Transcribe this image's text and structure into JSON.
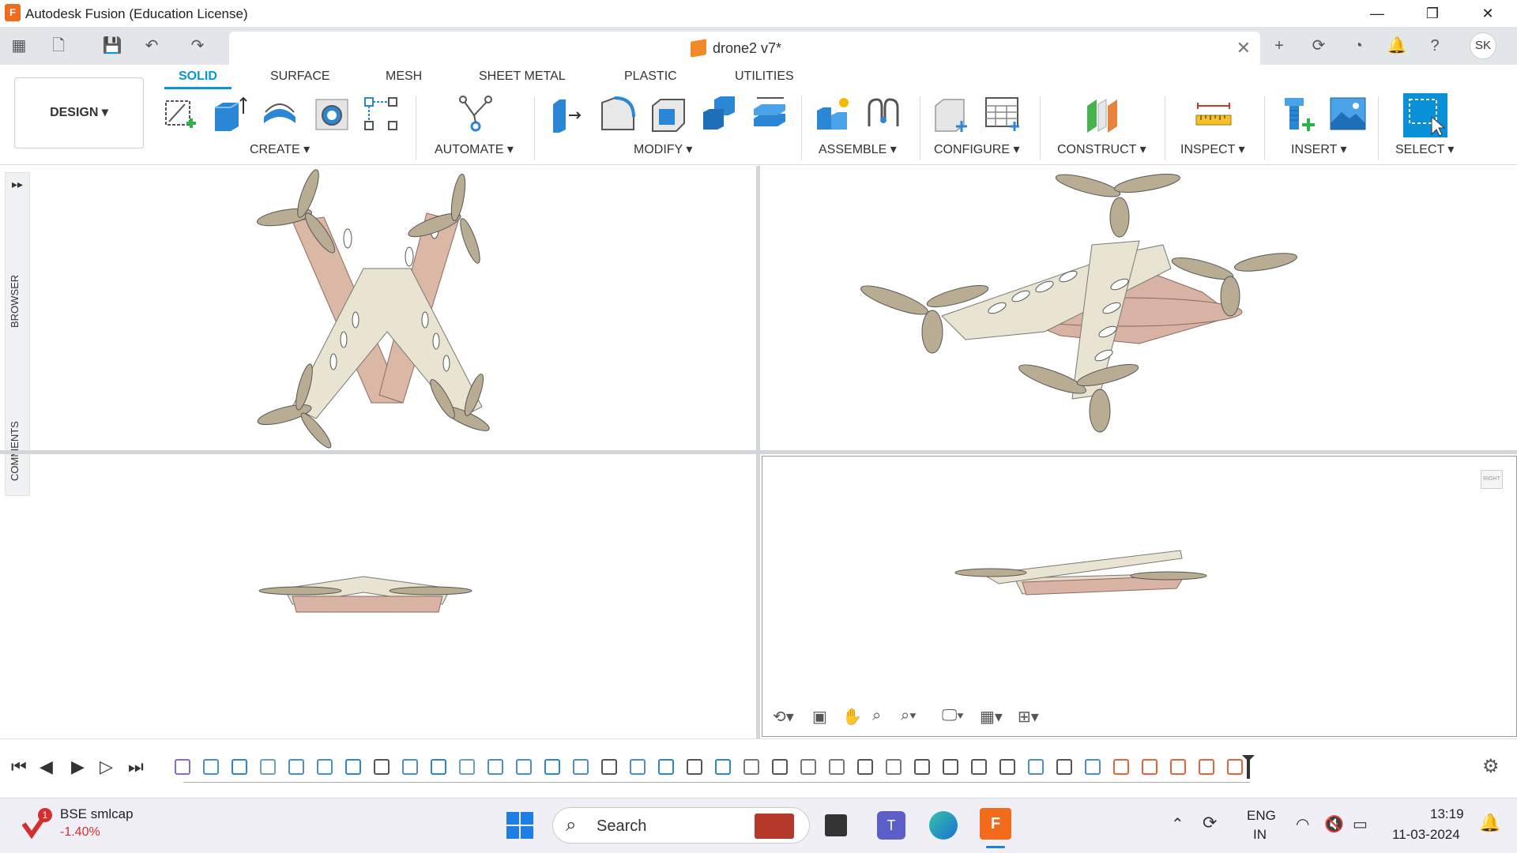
{
  "window": {
    "title": "Autodesk Fusion (Education License)"
  },
  "document": {
    "name": "drone2 v7*"
  },
  "user": {
    "initials": "SK"
  },
  "workspace": {
    "label": "DESIGN ▾"
  },
  "ribbon_tabs": [
    {
      "label": "SOLID",
      "active": true
    },
    {
      "label": "SURFACE"
    },
    {
      "label": "MESH"
    },
    {
      "label": "SHEET METAL"
    },
    {
      "label": "PLASTIC"
    },
    {
      "label": "UTILITIES"
    }
  ],
  "tool_groups": [
    {
      "label": "CREATE ▾"
    },
    {
      "label": "AUTOMATE ▾"
    },
    {
      "label": "MODIFY ▾"
    },
    {
      "label": "ASSEMBLE ▾"
    },
    {
      "label": "CONFIGURE ▾"
    },
    {
      "label": "CONSTRUCT ▾"
    },
    {
      "label": "INSPECT ▾"
    },
    {
      "label": "INSERT ▾"
    },
    {
      "label": "SELECT ▾"
    }
  ],
  "side_panel": {
    "browser": "BROWSER",
    "comments": "COMMENTS"
  },
  "viewcube": {
    "label": "RIGHT"
  },
  "taskbar": {
    "widget_title": "BSE smlcap",
    "widget_value": "-1.40%",
    "widget_badge": "1",
    "search_label": "Search",
    "lang_top": "ENG",
    "lang_bottom": "IN",
    "time": "13:19",
    "date": "11-03-2024"
  },
  "colors": {
    "accent": "#0696d7",
    "drone_body": "#e6e2cf",
    "drone_arms": "#d9b4a4",
    "propeller": "#b8ad92"
  }
}
